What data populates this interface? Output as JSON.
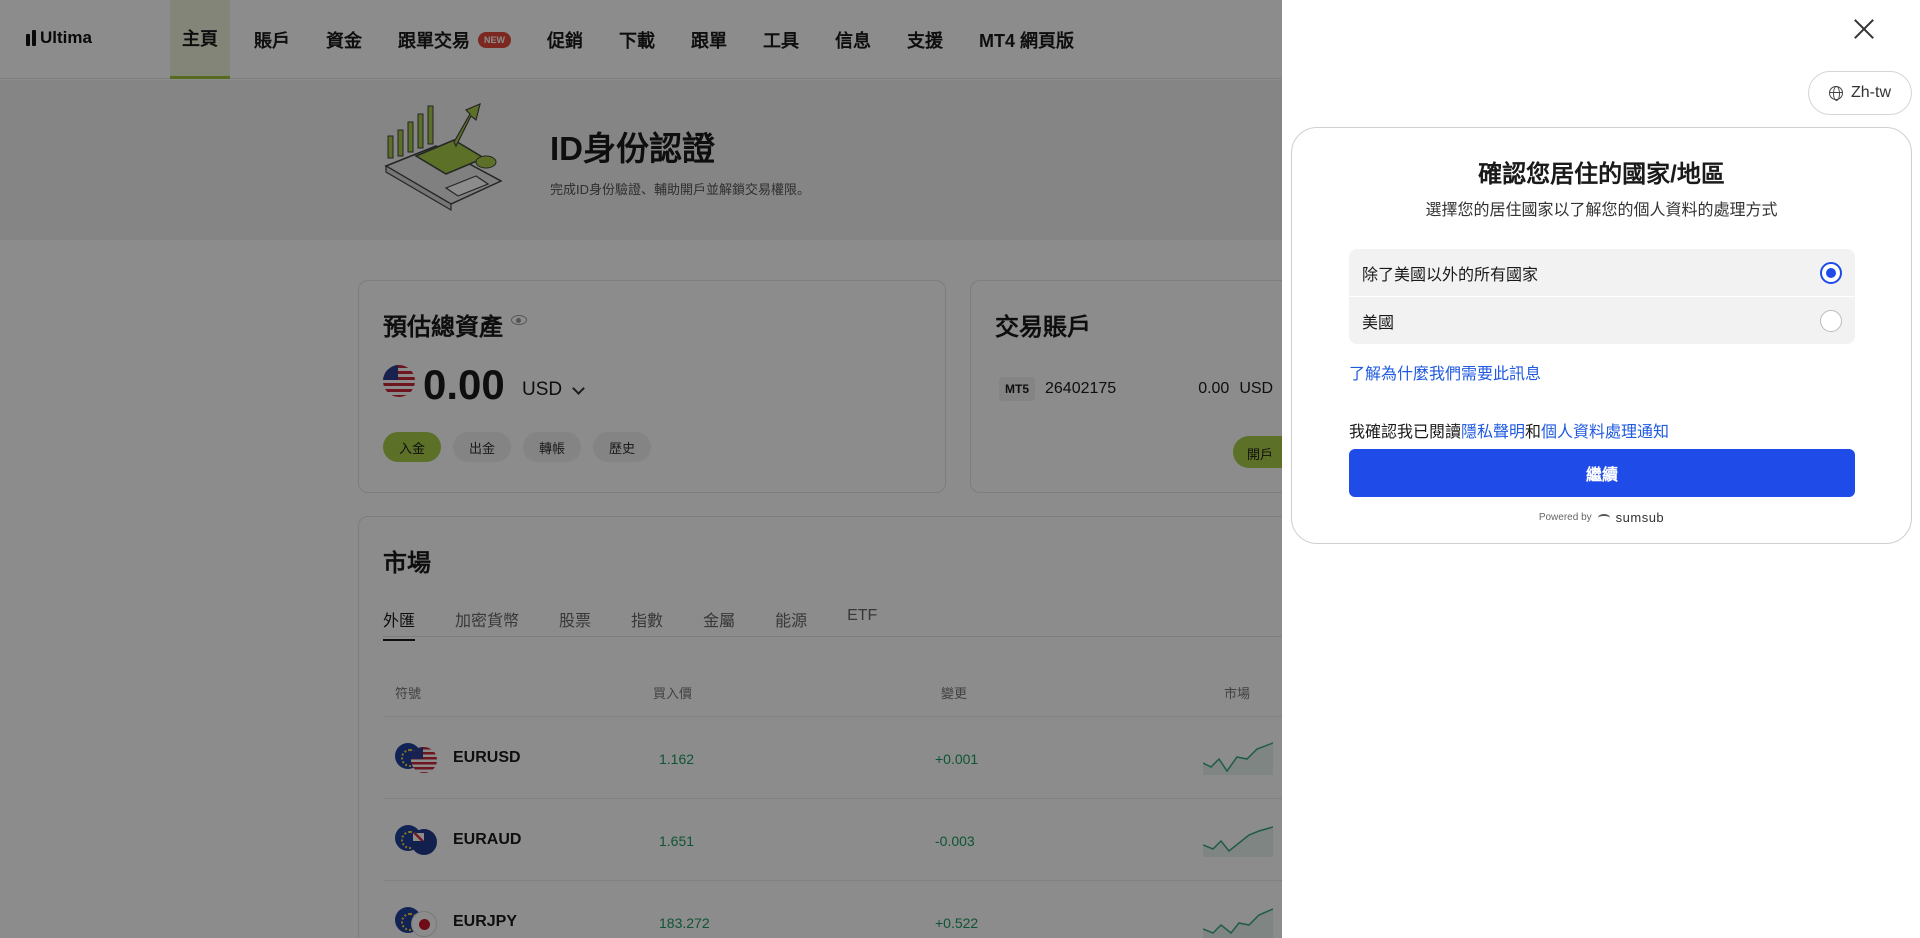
{
  "app": {
    "logo": "Ultima"
  },
  "nav": {
    "items": [
      {
        "label": "主頁",
        "active": true
      },
      {
        "label": "賬戶"
      },
      {
        "label": "資金"
      },
      {
        "label": "跟單交易",
        "badge": "NEW"
      },
      {
        "label": "促銷"
      },
      {
        "label": "下載"
      },
      {
        "label": "跟單"
      },
      {
        "label": "工具"
      },
      {
        "label": "信息"
      },
      {
        "label": "支援"
      },
      {
        "label": "MT4 網頁版"
      }
    ]
  },
  "banner": {
    "title": "ID身份認證",
    "subtitle": "完成ID身份驗證、輔助開戶並解鎖交易權限。"
  },
  "assets": {
    "title": "預估總資產",
    "amount": "0.00",
    "currency": "USD",
    "actions": [
      "入金",
      "出金",
      "轉帳",
      "歷史"
    ]
  },
  "accounts": {
    "title": "交易賬戶",
    "platform": "MT5",
    "account_id": "26402175",
    "balance": "0.00",
    "currency": "USD",
    "open_label": "開戶"
  },
  "market": {
    "title": "市場",
    "tabs": [
      "外匯",
      "加密貨幣",
      "股票",
      "指數",
      "金屬",
      "能源",
      "ETF"
    ],
    "columns": [
      "符號",
      "買入價",
      "變更",
      "市場"
    ],
    "rows": [
      {
        "symbol": "EURUSD",
        "bid": "1.162",
        "change": "+0.001"
      },
      {
        "symbol": "EURAUD",
        "bid": "1.651",
        "change": "-0.003"
      },
      {
        "symbol": "EURJPY",
        "bid": "183.272",
        "change": "+0.522"
      }
    ]
  },
  "drawer": {
    "language": "Zh-tw",
    "title": "確認您居住的國家/地區",
    "subtitle": "選擇您的居住國家以了解您的個人資料的處理方式",
    "options": [
      {
        "label": "除了美國以外的所有國家",
        "selected": true
      },
      {
        "label": "美國",
        "selected": false
      }
    ],
    "why_link": "了解為什麼我們需要此訊息",
    "consent_prefix": "我確認我已閱讀",
    "privacy_link": "隱私聲明",
    "consent_and": "和",
    "data_notice_link": "個人資料處理通知",
    "continue_label": "繼續",
    "powered_by": "Powered by",
    "powered_brand": "sumsub"
  },
  "colors": {
    "brand_green": "#a8cc4a",
    "primary_blue": "#1f4be8",
    "link_blue": "#1f5ae0",
    "up_green": "#1c9a5f"
  }
}
